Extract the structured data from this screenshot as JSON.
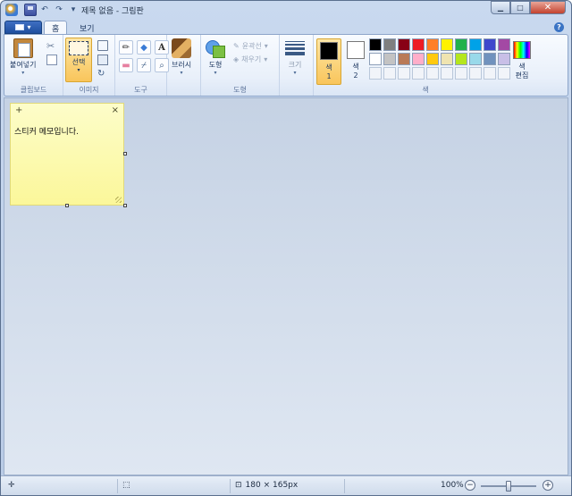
{
  "window": {
    "title": "제목 없음 - 그림판"
  },
  "qat": {
    "icons": [
      "save-icon",
      "undo-icon",
      "redo-icon",
      "customize-icon"
    ]
  },
  "tabs": {
    "home": "홈",
    "view": "보기"
  },
  "ribbon": {
    "clipboard": {
      "label": "클립보드",
      "paste": "붙여넣기"
    },
    "image": {
      "label": "이미지",
      "select": "선택"
    },
    "tools": {
      "label": "도구"
    },
    "brushes": {
      "label": "브러시"
    },
    "shapes": {
      "label": "도형",
      "shapes_btn": "도형",
      "outline": "윤곽선",
      "fill": "채우기"
    },
    "size": {
      "label": "크기"
    },
    "colors": {
      "label": "색",
      "color1_a": "색",
      "color1_b": "1",
      "color2_a": "색",
      "color2_b": "2",
      "color1_value": "#000000",
      "color2_value": "#ffffff",
      "edit_a": "색",
      "edit_b": "편집",
      "palette": [
        "#000000",
        "#7f7f7f",
        "#880015",
        "#ed1c24",
        "#ff7f27",
        "#fff200",
        "#22b14c",
        "#00a2e8",
        "#3f48cc",
        "#a349a4",
        "#ffffff",
        "#c3c3c3",
        "#b97a57",
        "#ffaec9",
        "#ffc90e",
        "#efe4b0",
        "#b5e61d",
        "#99d9ea",
        "#7092be",
        "#c8bfe7",
        "",
        "",
        "",
        "",
        "",
        "",
        "",
        "",
        "",
        ""
      ]
    }
  },
  "sticky": {
    "add": "+",
    "close": "×",
    "text": "스티커 메모입니다."
  },
  "status": {
    "dimensions": "180 × 165px",
    "zoom": "100%"
  }
}
